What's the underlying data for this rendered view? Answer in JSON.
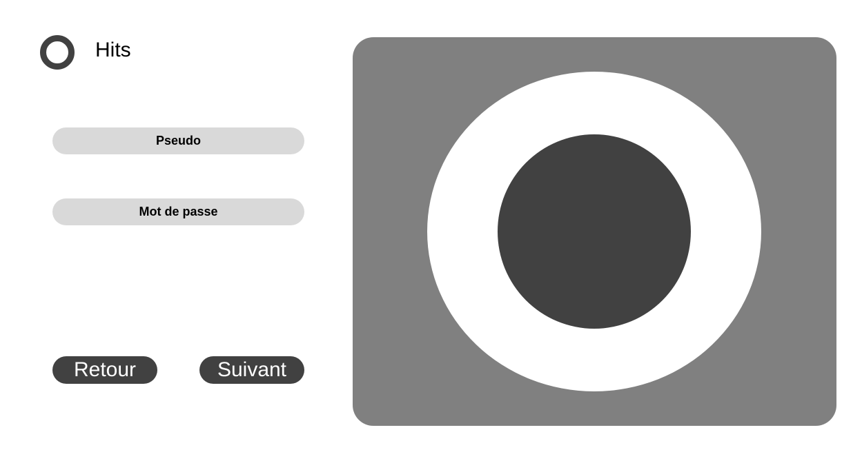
{
  "header": {
    "title": "Hits",
    "logo_icon": "ring-logo-icon"
  },
  "form": {
    "pseudo_placeholder": "Pseudo",
    "password_placeholder": "Mot de passe"
  },
  "actions": {
    "back_label": "Retour",
    "next_label": "Suivant"
  },
  "image_placeholder": {
    "icon": "image-placeholder-icon"
  },
  "colors": {
    "dark": "#414141",
    "field_bg": "#d9d9d9",
    "panel_bg": "#808080",
    "background": "#ffffff"
  }
}
